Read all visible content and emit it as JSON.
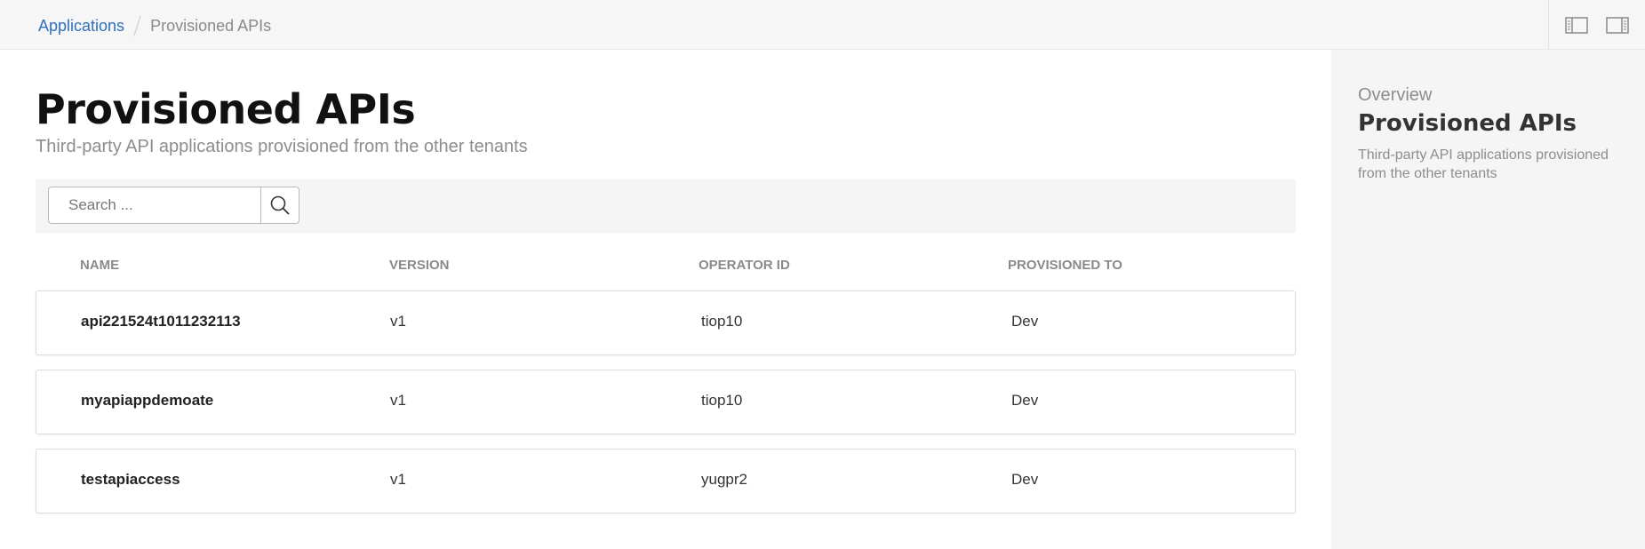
{
  "breadcrumb": {
    "root": "Applications",
    "current": "Provisioned APIs"
  },
  "topbar": {
    "icons": [
      "sidebar-left-icon",
      "sidebar-right-icon"
    ]
  },
  "page": {
    "title": "Provisioned APIs",
    "subtitle": "Third-party API applications provisioned from the other tenants"
  },
  "search": {
    "placeholder": "Search ...",
    "value": ""
  },
  "table": {
    "columns": [
      "NAME",
      "VERSION",
      "OPERATOR ID",
      "PROVISIONED TO"
    ],
    "rows": [
      {
        "name": "api221524t1011232113",
        "version": "v1",
        "operator_id": "tiop10",
        "provisioned_to": "Dev"
      },
      {
        "name": "myapiappdemoate",
        "version": "v1",
        "operator_id": "tiop10",
        "provisioned_to": "Dev"
      },
      {
        "name": "testapiaccess",
        "version": "v1",
        "operator_id": "yugpr2",
        "provisioned_to": "Dev"
      }
    ]
  },
  "sidebar": {
    "overline": "Overview",
    "title": "Provisioned APIs",
    "description": "Third-party API applications provisioned from the other tenants"
  },
  "colors": {
    "link": "#2f6fbd",
    "muted": "#8d8d8d",
    "panel": "#f5f5f5"
  }
}
